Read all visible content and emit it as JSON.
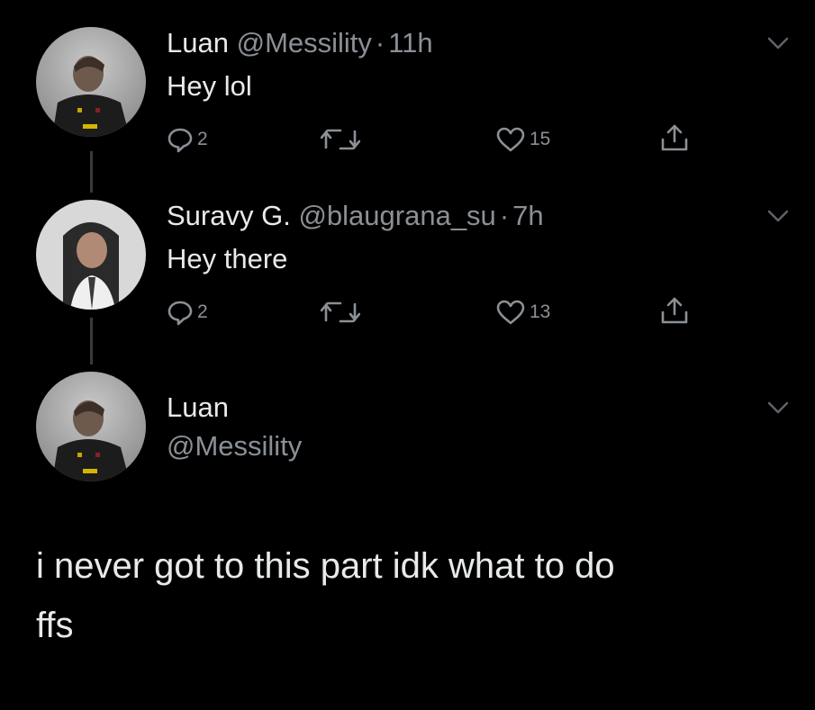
{
  "tweets": [
    {
      "name": "Luan",
      "handle": "@Messility",
      "separator": "·",
      "time": "11h",
      "text": "Hey lol",
      "reply_count": "2",
      "like_count": "15",
      "avatar_icon": "soccer-player-avatar"
    },
    {
      "name": "Suravy G.",
      "handle": "@blaugrana_su",
      "separator": "·",
      "time": "7h",
      "text": "Hey there",
      "reply_count": "2",
      "like_count": "13",
      "avatar_icon": "selfie-avatar"
    }
  ],
  "compose": {
    "name": "Luan",
    "handle": "@Messility",
    "avatar_icon": "soccer-player-avatar"
  },
  "caption": {
    "line1": "i never got to this part idk what to do",
    "line2": "ffs"
  },
  "icons": {
    "reply": "speech-bubble-icon",
    "retweet": "retweet-arrows-icon",
    "like": "heart-icon",
    "share": "share-upload-icon",
    "more": "chevron-down-icon"
  },
  "colors": {
    "background": "#000000",
    "text_primary": "#e7e9ea",
    "text_secondary": "#8b9096",
    "thread_line": "#3a3a3a"
  }
}
